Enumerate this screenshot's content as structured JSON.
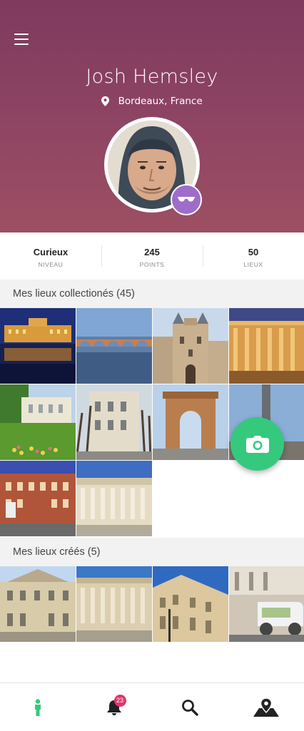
{
  "profile": {
    "name": "Josh Hemsley",
    "location": "Bordeaux, France"
  },
  "stats": [
    {
      "value": "Curieux",
      "label": "NIVEAU"
    },
    {
      "value": "245",
      "label": "POINTS"
    },
    {
      "value": "50",
      "label": "LIEUX"
    }
  ],
  "collected": {
    "title": "Mes lieux collectionés (45)",
    "photos": [
      "place-de-la-bourse-night",
      "pont-de-pierre",
      "porte-cailhau",
      "grand-theatre-night",
      "garden-villa",
      "courtyard-building",
      "porte-dijeaux",
      "monument-column",
      "brick-building",
      "grand-theatre-facade"
    ]
  },
  "created": {
    "title": "Mes lieux créés (5)",
    "photos": [
      "palace-courtyard",
      "grand-theatre",
      "corner-building",
      "street-rickshaw"
    ]
  },
  "tabs": {
    "profile": "profile-icon",
    "notifications": "bell-icon",
    "notification_count": "23",
    "search": "search-icon",
    "map": "map-pin-icon"
  },
  "colors": {
    "header": "#8c4363",
    "fab": "#35c97d",
    "badge": "#9f6cc9",
    "notification": "#e2366a",
    "active_tab": "#35c97d"
  }
}
